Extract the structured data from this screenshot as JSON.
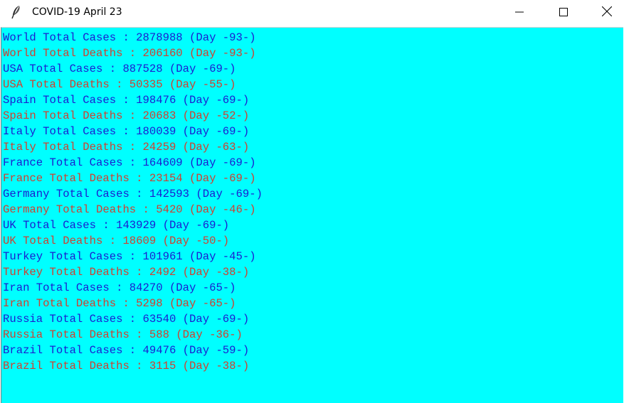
{
  "window": {
    "title": "COVID-19 April 23",
    "icon": "feather-icon",
    "controls": {
      "minimize": "minimize-icon",
      "maximize": "maximize-icon",
      "close": "close-icon"
    }
  },
  "colors": {
    "background": "#00ffff",
    "cases_text": "#1c1cd0",
    "deaths_text": "#d04030"
  },
  "lines": [
    {
      "type": "cases",
      "text": "World Total Cases : 2878988 (Day -93-)"
    },
    {
      "type": "deaths",
      "text": "World Total Deaths : 206160 (Day -93-)"
    },
    {
      "type": "cases",
      "text": "USA Total Cases : 887528 (Day -69-)"
    },
    {
      "type": "deaths",
      "text": "USA Total Deaths : 50335 (Day -55-)"
    },
    {
      "type": "cases",
      "text": "Spain Total Cases : 198476 (Day -69-)"
    },
    {
      "type": "deaths",
      "text": "Spain Total Deaths : 20683 (Day -52-)"
    },
    {
      "type": "cases",
      "text": "Italy Total Cases : 180039 (Day -69-)"
    },
    {
      "type": "deaths",
      "text": "Italy Total Deaths : 24259 (Day -63-)"
    },
    {
      "type": "cases",
      "text": "France Total Cases : 164609 (Day -69-)"
    },
    {
      "type": "deaths",
      "text": "France Total Deaths : 23154 (Day -69-)"
    },
    {
      "type": "cases",
      "text": "Germany Total Cases : 142593 (Day -69-)"
    },
    {
      "type": "deaths",
      "text": "Germany Total Deaths : 5420 (Day -46-)"
    },
    {
      "type": "cases",
      "text": "UK Total Cases : 143929 (Day -69-)"
    },
    {
      "type": "deaths",
      "text": "UK Total Deaths : 18609 (Day -50-)"
    },
    {
      "type": "cases",
      "text": "Turkey Total Cases : 101961 (Day -45-)"
    },
    {
      "type": "deaths",
      "text": "Turkey Total Deaths : 2492 (Day -38-)"
    },
    {
      "type": "cases",
      "text": "Iran Total Cases : 84270 (Day -65-)"
    },
    {
      "type": "deaths",
      "text": "Iran Total Deaths : 5298 (Day -65-)"
    },
    {
      "type": "cases",
      "text": "Russia Total Cases : 63540 (Day -69-)"
    },
    {
      "type": "deaths",
      "text": "Russia Total Deaths : 588 (Day -36-)"
    },
    {
      "type": "cases",
      "text": "Brazil Total Cases : 49476 (Day -59-)"
    },
    {
      "type": "deaths",
      "text": "Brazil Total Deaths : 3115 (Day -38-)"
    }
  ]
}
